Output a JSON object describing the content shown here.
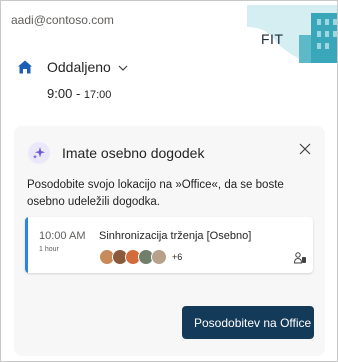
{
  "account": {
    "email": "aadi@contoso.com"
  },
  "badge": {
    "label": "FIT"
  },
  "status": {
    "label": "Oddaljeno",
    "icon": "home-icon"
  },
  "hours": {
    "start": "9:00",
    "end": "17:00"
  },
  "card": {
    "title": "Imate osebno dogodek",
    "message": "Posodobite svojo lokacijo na »Office«, da se boste osebno udeležili dogodka.",
    "event": {
      "time": "10:00 AM",
      "duration": "1 hour",
      "title": "Sinhronizacija trženja [Osebno]",
      "more_attendees": "+6",
      "accent": "#2b88d8"
    },
    "action_label": "Posodobitev na Office"
  },
  "colors": {
    "accent": "#1a5fb4",
    "button": "#143a5a",
    "card_bg": "#f7f7f7"
  }
}
